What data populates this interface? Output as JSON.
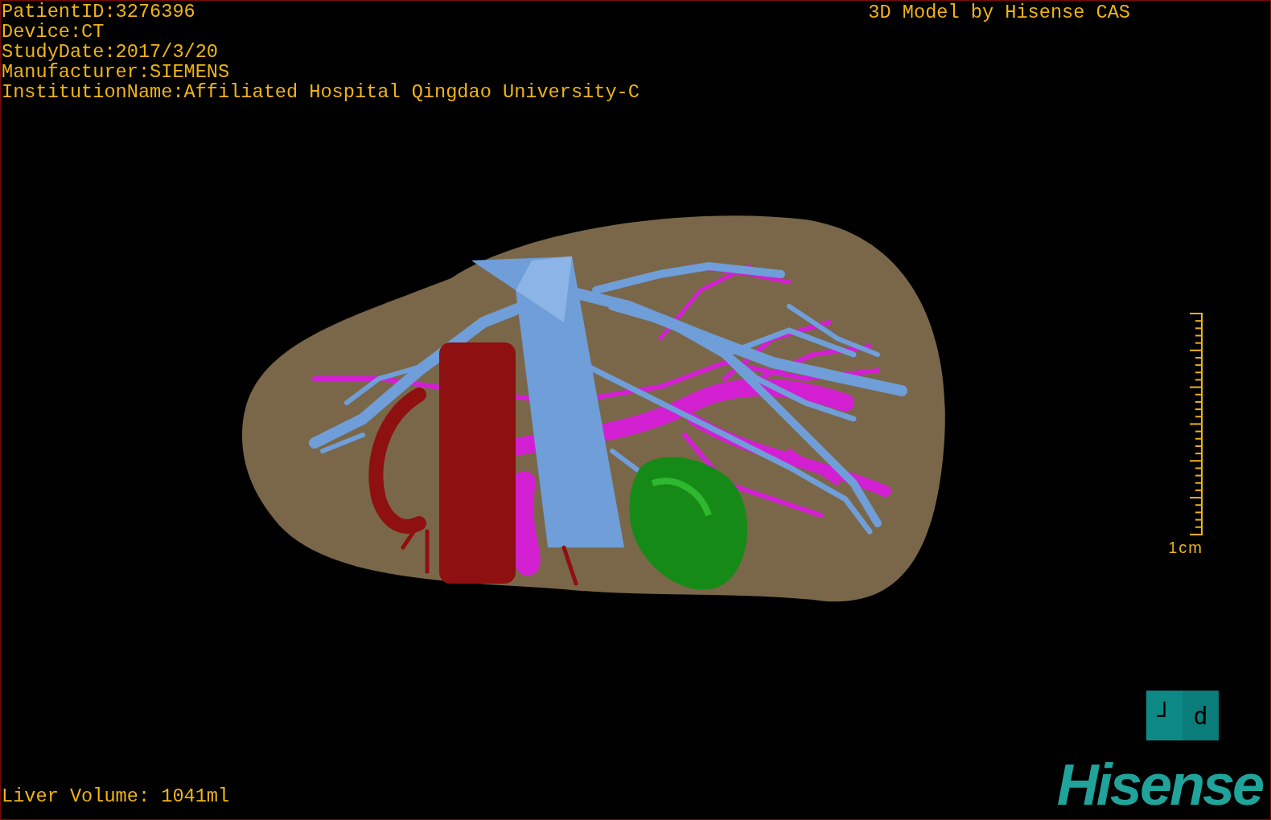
{
  "patient_info": [
    "PatientID:3276396",
    "Device:CT",
    "StudyDate:2017/3/20",
    "Manufacturer:SIEMENS",
    "InstitutionName:Affiliated Hospital Qingdao University-C"
  ],
  "credit": "3D Model by Hisense CAS",
  "scale_bar": {
    "label": "1cm"
  },
  "orientation_cube": {
    "faces": [
      "┘",
      "d"
    ]
  },
  "liver_volume": "Liver Volume: 1041ml",
  "logo": "Hisense"
}
